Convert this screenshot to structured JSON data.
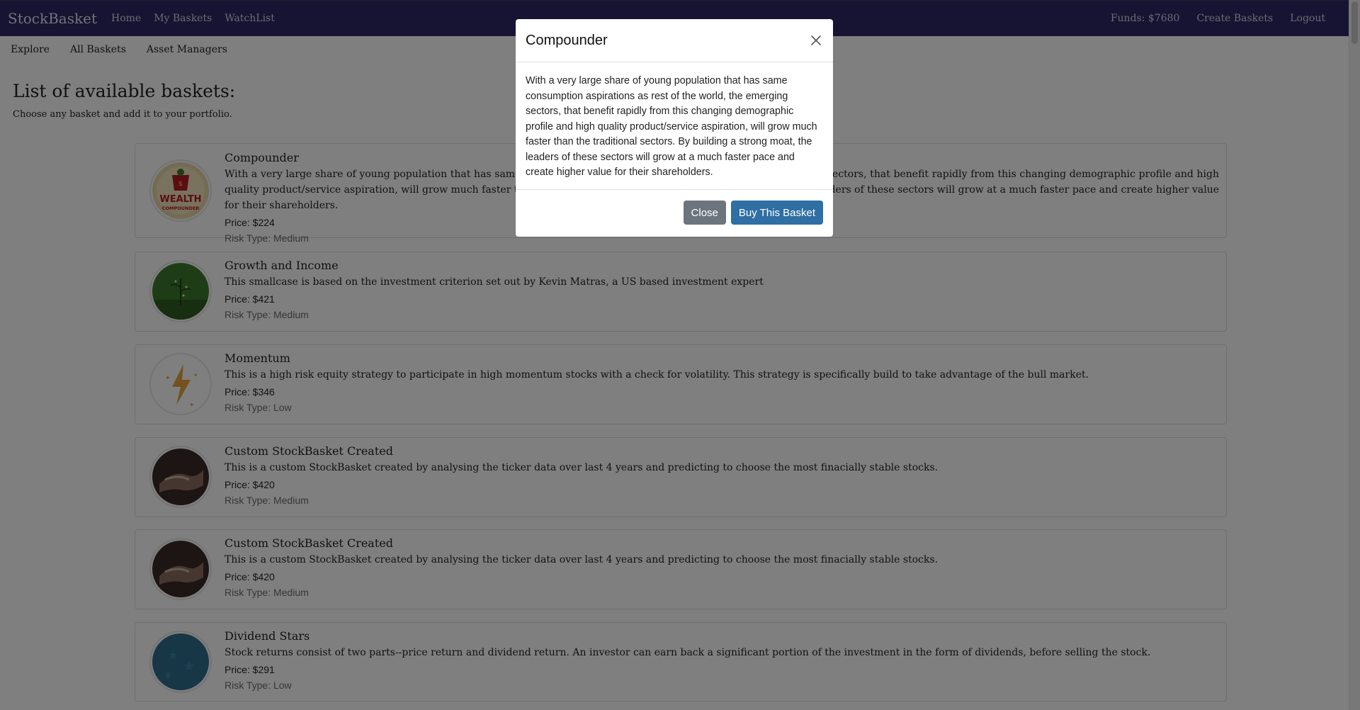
{
  "navbar": {
    "brand": "StockBasket",
    "links": [
      "Home",
      "My Baskets",
      "WatchList"
    ],
    "funds": "Funds: $7680",
    "create": "Create Baskets",
    "logout": "Logout"
  },
  "subnav": [
    "Explore",
    "All Baskets",
    "Asset Managers"
  ],
  "page": {
    "heading": "List of available baskets:",
    "subheading": "Choose any basket and add it to your portfolio."
  },
  "baskets": [
    {
      "title": "Compounder",
      "description": "With a very large share of young population that has same consumption aspirations as rest of the world, the emerging sectors, that benefit rapidly from this changing demographic profile and high quality product/service aspiration, will grow much faster than the traditional sectors. By building a strong moat, the leaders of these sectors will grow at a much faster pace and create higher value for their shareholders.",
      "price": "Price: $224",
      "risk": "Risk Type: Medium",
      "icon": "wealth-compounder-logo",
      "logo_text": "WEALTH",
      "logo_subtext": "COMPOUNDER"
    },
    {
      "title": "Growth and Income",
      "description": "This smallcase is based on the investment criterion set out by Kevin Matras, a US based investment expert",
      "price": "Price: $421",
      "risk": "Risk Type: Medium",
      "icon": "plant-growth-image"
    },
    {
      "title": "Momentum",
      "description": "This is a high risk equity strategy to participate in high momentum stocks with a check for volatility. This strategy is specifically build to take advantage of the bull market.",
      "price": "Price: $346",
      "risk": "Risk Type: Low",
      "icon": "lightning-bolt-icon"
    },
    {
      "title": "Custom StockBasket Created",
      "description": "This is a custom StockBasket created by analysing the ticker data over last 4 years and predicting to choose the most finacially stable stocks.",
      "price": "Price: $420",
      "risk": "Risk Type: Medium",
      "icon": "handshake-image"
    },
    {
      "title": "Custom StockBasket Created",
      "description": "This is a custom StockBasket created by analysing the ticker data over last 4 years and predicting to choose the most finacially stable stocks.",
      "price": "Price: $420",
      "risk": "Risk Type: Medium",
      "icon": "handshake-image"
    },
    {
      "title": "Dividend Stars",
      "description": "Stock returns consist of two parts--price return and dividend return. An investor can earn back a significant portion of the investment in the form of dividends, before selling the stock.",
      "price": "Price: $291",
      "risk": "Risk Type: Low",
      "icon": "stars-image"
    }
  ],
  "modal": {
    "title": "Compounder",
    "body": "With a very large share of young population that has same consumption aspirations as rest of the world, the emerging sectors, that benefit rapidly from this changing demographic profile and high quality product/service aspiration, will grow much faster than the traditional sectors. By building a strong moat, the leaders of these sectors will grow at a much faster pace and create higher value for their shareholders.",
    "close_label": "Close",
    "buy_label": "Buy This Basket",
    "close_icon": "close-icon"
  },
  "colors": {
    "navbar": "#2c2666",
    "primary_button": "#2f6fa3",
    "secondary_button": "#6c757d"
  }
}
